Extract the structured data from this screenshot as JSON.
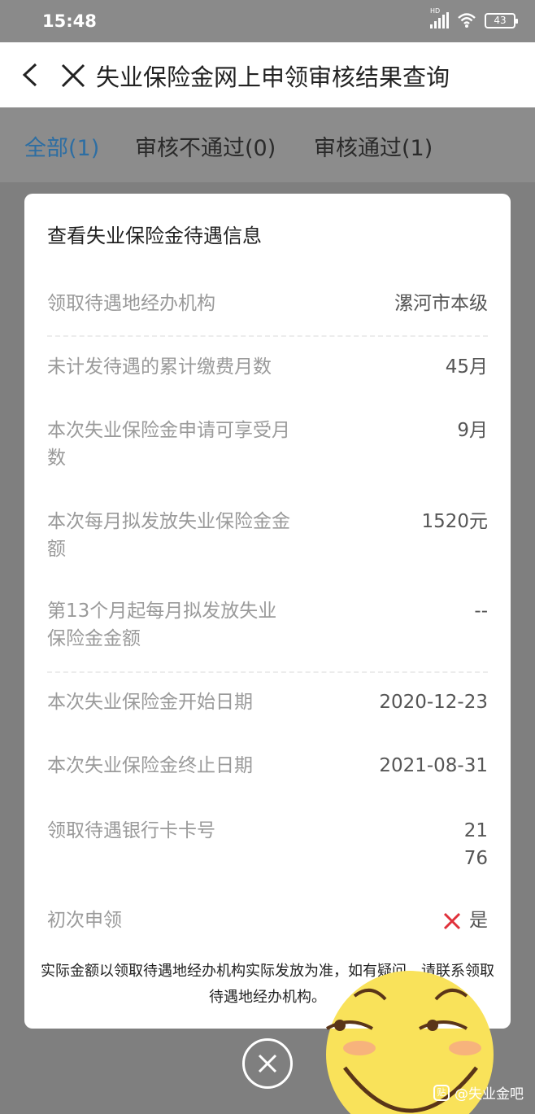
{
  "status_bar": {
    "time": "15:48",
    "net_badge": "HD",
    "battery": "43"
  },
  "header": {
    "title": "失业保险金网上申领审核结果查询"
  },
  "tabs": [
    {
      "label": "全部(1)"
    },
    {
      "label": "审核不通过(0)"
    },
    {
      "label": "审核通过(1)"
    }
  ],
  "modal": {
    "title": "查看失业保险金待遇信息",
    "rows": [
      {
        "label": "领取待遇地经办机构",
        "value": "漯河市本级"
      },
      {
        "label": "未计发待遇的累计缴费月数",
        "value": "45月"
      },
      {
        "label": "本次失业保险金申请可享受月数",
        "value": "9月"
      },
      {
        "label": "本次每月拟发放失业保险金金额",
        "value": "1520元"
      },
      {
        "label": "第13个月起每月拟发放失业保险金金额",
        "value": "--"
      },
      {
        "label": "本次失业保险金开始日期",
        "value": "2020-12-23"
      },
      {
        "label": "本次失业保险金终止日期",
        "value": "2021-08-31"
      },
      {
        "label": "领取待遇银行卡卡号",
        "value_line1": "21",
        "value_line2": "76"
      },
      {
        "label": "初次申领",
        "value": "是"
      }
    ],
    "notice": "实际金额以领取待遇地经办机构实际发放为准，如有疑问，请联系领取待遇地经办机构。"
  },
  "watermark": {
    "logo": "贴",
    "text": "@失业金吧"
  },
  "colors": {
    "accent": "#2d6ea3",
    "mark_red": "#e0303a",
    "sticker_yellow": "#f9e25a"
  }
}
